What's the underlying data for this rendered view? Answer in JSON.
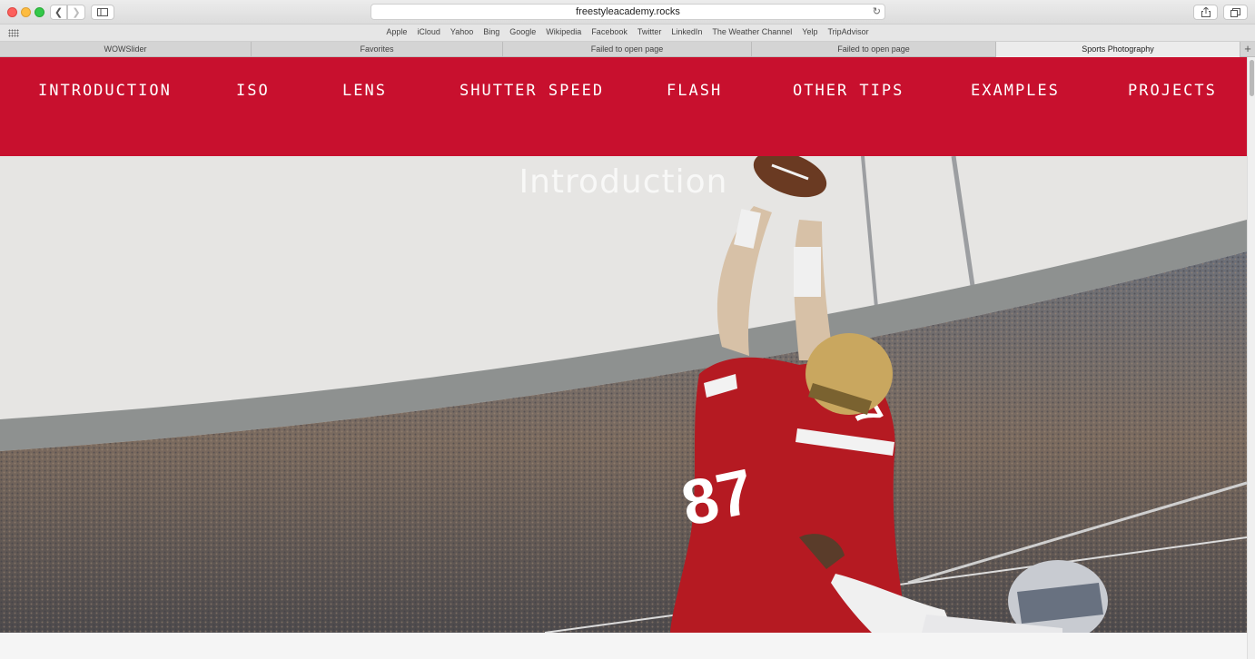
{
  "browser": {
    "url": "freestyleacademy.rocks",
    "bookmarks": [
      "Apple",
      "iCloud",
      "Yahoo",
      "Bing",
      "Google",
      "Wikipedia",
      "Facebook",
      "Twitter",
      "LinkedIn",
      "The Weather Channel",
      "Yelp",
      "TripAdvisor"
    ],
    "tabs": [
      "WOWSlider",
      "Favorites",
      "Failed to open page",
      "Failed to open page",
      "Sports Photography"
    ],
    "active_tab": "Sports Photography",
    "icons": {
      "back": "chevron-left-icon",
      "forward": "chevron-right-icon",
      "sidebar": "sidebar-icon",
      "reload": "reload-icon",
      "share": "share-icon",
      "tabs": "tabs-overview-icon",
      "new_tab": "plus-icon",
      "top_sites": "grid-icon"
    }
  },
  "site": {
    "nav_items": [
      "INTRODUCTION",
      "ISO",
      "LENS",
      "SHUTTER SPEED",
      "FLASH",
      "OTHER TIPS",
      "EXAMPLES",
      "PROJECTS"
    ],
    "hero_title": "Introduction",
    "colors": {
      "nav_red": "#c8102e",
      "jersey_red": "#b51a22"
    }
  }
}
